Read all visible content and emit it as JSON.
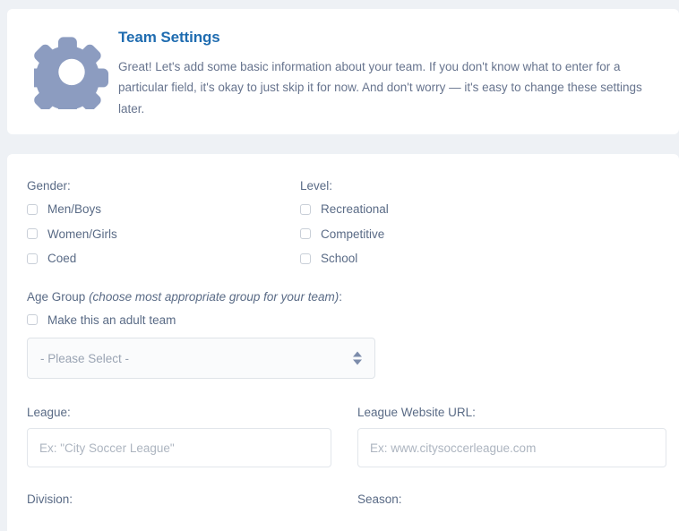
{
  "intro": {
    "icon": "gear-icon",
    "title": "Team Settings",
    "description": "Great! Let's add some basic information about your team. If you don't know what to enter for a particular field, it's okay to just skip it for now. And don't worry — it's easy to change these settings later.",
    "title_color": "#1f6cb0",
    "icon_color": "#8c9cc0",
    "text_color": "#67748e"
  },
  "form": {
    "gender": {
      "label": "Gender:",
      "options": [
        {
          "label": "Men/Boys",
          "checked": false
        },
        {
          "label": "Women/Girls",
          "checked": false
        },
        {
          "label": "Coed",
          "checked": false
        }
      ]
    },
    "level": {
      "label": "Level:",
      "options": [
        {
          "label": "Recreational",
          "checked": false
        },
        {
          "label": "Competitive",
          "checked": false
        },
        {
          "label": "School",
          "checked": false
        }
      ]
    },
    "age_group": {
      "label": "Age Group",
      "hint": "(choose most appropriate group for your team)",
      "label_suffix": ":",
      "adult_checkbox": {
        "label": "Make this an adult team",
        "checked": false
      },
      "select": {
        "value": "- Please Select -",
        "arrows_icon": "sort-arrows-icon"
      }
    },
    "league": {
      "label": "League:",
      "value": "",
      "placeholder": "Ex: \"City Soccer League\""
    },
    "league_url": {
      "label": "League Website URL:",
      "value": "",
      "placeholder": "Ex: www.citysoccerleague.com"
    },
    "division": {
      "label": "Division:"
    },
    "season": {
      "label": "Season:"
    }
  }
}
